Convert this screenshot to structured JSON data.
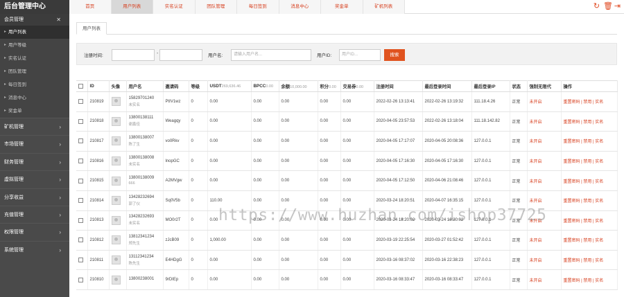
{
  "app": {
    "logo": "后台管理中心"
  },
  "topnav": {
    "tabs": [
      {
        "label": "首页",
        "active": false
      },
      {
        "label": "用户列表",
        "active": true
      },
      {
        "label": "实名认证",
        "active": false
      },
      {
        "label": "团队管理",
        "active": false
      },
      {
        "label": "每日签到",
        "active": false
      },
      {
        "label": "消息中心",
        "active": false
      },
      {
        "label": "奖金单",
        "active": false
      },
      {
        "label": "矿机列表",
        "active": false
      }
    ],
    "icons": [
      "refresh-icon",
      "trash-icon",
      "logout-icon"
    ]
  },
  "sidebar": {
    "open_group": "会员管理",
    "subitems": [
      {
        "label": "用户列表",
        "active": true
      },
      {
        "label": "用户等级",
        "active": false
      },
      {
        "label": "实名认证",
        "active": false
      },
      {
        "label": "团队管理",
        "active": false
      },
      {
        "label": "每日签到",
        "active": false
      },
      {
        "label": "消息中心",
        "active": false
      },
      {
        "label": "奖金单",
        "active": false
      }
    ],
    "groups": [
      "矿机管理",
      "市场管理",
      "财务管理",
      "虚拟管理",
      "分享收益",
      "充值管理",
      "权限管理",
      "系统管理"
    ]
  },
  "main": {
    "subtab": "用户列表",
    "filter": {
      "reg_time_label": "注册时间:",
      "dash": "-",
      "username_label": "用户名:",
      "username_placeholder": "请输入用户名...",
      "uid_label": "用户ID:",
      "uid_placeholder": "用户ID...",
      "search_button": "搜索"
    }
  },
  "table": {
    "headers": {
      "id": "ID",
      "avatar": "头像",
      "username": "用户名",
      "invite": "邀请码",
      "level": "等级",
      "usdt": "USDT",
      "usdt_total": "269,636.46",
      "bpcc": "BPCC",
      "bpcc_total": "0.00",
      "balance": "余额",
      "balance_total": "10,000.00",
      "points": "积分",
      "points_total": "0.00",
      "trade": "交易券",
      "trade_total": "0.00",
      "reg_time": "注册时间",
      "last_login": "最后登录时间",
      "last_ip": "最后登录IP",
      "status": "状态",
      "withdraw": "强制无限代",
      "ops": "操作"
    },
    "rows": [
      {
        "id": "210819",
        "phone": "15829701240",
        "name": "未实名",
        "invite": "PtIV1wz",
        "level": "0",
        "usdt": "0.00",
        "bpcc": "0.00",
        "balance": "0.00",
        "points": "0.00",
        "trade": "0.00",
        "reg": "2022-02-26 13:13:41",
        "login": "2022-02-26 13:19:32",
        "ip": "111.18.4.26",
        "status": "正常",
        "withdraw": "未开启",
        "ops": "重置密码 | 禁用 | 实名"
      },
      {
        "id": "210818",
        "phone": "13800138111",
        "name": "谢鑫佳",
        "invite": "Weagqy",
        "level": "0",
        "usdt": "0.00",
        "bpcc": "0.00",
        "balance": "0.00",
        "points": "0.00",
        "trade": "0.00",
        "reg": "2020-04-05 23:57:53",
        "login": "2022-02-26 13:18:04",
        "ip": "111.18.142.82",
        "status": "正常",
        "withdraw": "未开启",
        "ops": "重置密码 | 禁用 | 实名"
      },
      {
        "id": "210817",
        "phone": "13800138007",
        "name": "陈了生",
        "invite": "vo0Rkv",
        "level": "0",
        "usdt": "0.00",
        "bpcc": "0.00",
        "balance": "0.00",
        "points": "0.00",
        "trade": "0.00",
        "reg": "2020-04-05 17:17:07",
        "login": "2020-04-05 20:08:36",
        "ip": "127.0.0.1",
        "status": "正常",
        "withdraw": "未开启",
        "ops": "重置密码 | 禁用 | 实名"
      },
      {
        "id": "210816",
        "phone": "13800138008",
        "name": "未实名",
        "invite": "lnopGC",
        "level": "0",
        "usdt": "0.00",
        "bpcc": "0.00",
        "balance": "0.00",
        "points": "0.00",
        "trade": "0.00",
        "reg": "2020-04-05 17:16:30",
        "login": "2020-04-05 17:16:30",
        "ip": "127.0.0.1",
        "status": "正常",
        "withdraw": "未开启",
        "ops": "重置密码 | 禁用 | 实名"
      },
      {
        "id": "210815",
        "phone": "13800138009",
        "name": "666",
        "invite": "A2MVgw",
        "level": "0",
        "usdt": "0.00",
        "bpcc": "0.00",
        "balance": "0.00",
        "points": "0.00",
        "trade": "0.00",
        "reg": "2020-04-05 17:12:50",
        "login": "2020-04-06 21:08:46",
        "ip": "127.0.0.1",
        "status": "正常",
        "withdraw": "未开启",
        "ops": "重置密码 | 禁用 | 实名"
      },
      {
        "id": "210814",
        "phone": "13428232694",
        "name": "郭了仪",
        "invite": "Sq0V5b",
        "level": "0",
        "usdt": "110.00",
        "bpcc": "0.00",
        "balance": "0.00",
        "points": "0.00",
        "trade": "0.00",
        "reg": "2020-03-24 18:20:51",
        "login": "2020-04-07 16:35:15",
        "ip": "127.0.0.1",
        "status": "正常",
        "withdraw": "未开启",
        "ops": "重置密码 | 禁用 | 实名"
      },
      {
        "id": "210813",
        "phone": "13428232693",
        "name": "未实名",
        "invite": "MO0r2T",
        "level": "0",
        "usdt": "0.00",
        "bpcc": "0.00",
        "balance": "0.00",
        "points": "0.00",
        "trade": "0.00",
        "reg": "2020-03-24 18:20:02",
        "login": "2020-03-24 18:20:02",
        "ip": "127.0.0.1",
        "status": "正常",
        "withdraw": "未开启",
        "ops": "重置密码 | 禁用 | 实名"
      },
      {
        "id": "210812",
        "phone": "13812341234",
        "name": "郑先生",
        "invite": "zJcB09",
        "level": "0",
        "usdt": "1,000.00",
        "bpcc": "0.00",
        "balance": "0.00",
        "points": "0.00",
        "trade": "0.00",
        "reg": "2020-03-19 22:25:54",
        "login": "2020-03-27 01:52:42",
        "ip": "127.0.0.1",
        "status": "正常",
        "withdraw": "未开启",
        "ops": "重置密码 | 禁用 | 实名"
      },
      {
        "id": "210811",
        "phone": "13112341234",
        "name": "陈先生",
        "invite": "E4HDgG",
        "level": "0",
        "usdt": "0.00",
        "bpcc": "0.00",
        "balance": "0.00",
        "points": "0.00",
        "trade": "0.00",
        "reg": "2020-03-16 08:37:02",
        "login": "2020-03-16 22:38:23",
        "ip": "127.0.0.1",
        "status": "正常",
        "withdraw": "未开启",
        "ops": "重置密码 | 禁用 | 实名"
      },
      {
        "id": "210810",
        "phone": "13800238001",
        "name": "",
        "invite": "9rDIEp",
        "level": "0",
        "usdt": "0.00",
        "bpcc": "0.00",
        "balance": "0.00",
        "points": "0.00",
        "trade": "0.00",
        "reg": "2020-03-16 08:33:47",
        "login": "2020-03-16 08:33:47",
        "ip": "127.0.0.1",
        "status": "正常",
        "withdraw": "未开启",
        "ops": "重置密码 | 禁用 | 实名"
      }
    ]
  },
  "watermark": "https://www.huzhan.com/ishop37725"
}
